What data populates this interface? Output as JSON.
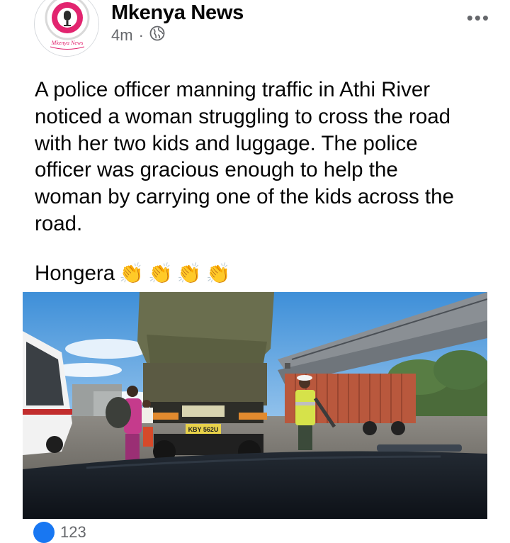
{
  "post": {
    "page_name": "Mkenya News",
    "avatar_text": "Mkenya News",
    "time": "4m",
    "separator": "·",
    "privacy_icon": "globe-icon",
    "more_icon": "•••",
    "text_paragraph": "A police officer manning traffic in Athi River\nnoticed a woman struggling to cross the road\nwith her two kids and luggage. The police\nofficer was gracious enough to help the\nwoman by carrying one of the kids across the\nroad.",
    "text_second": "Hongera",
    "emojis": [
      "👏",
      "👏",
      "👏",
      "👏"
    ],
    "truck_plate": "KBY 562U",
    "reaction_count": "123"
  },
  "colors": {
    "accent": "#e2246f",
    "secondary_text": "#65676b",
    "like_blue": "#1877f2"
  }
}
